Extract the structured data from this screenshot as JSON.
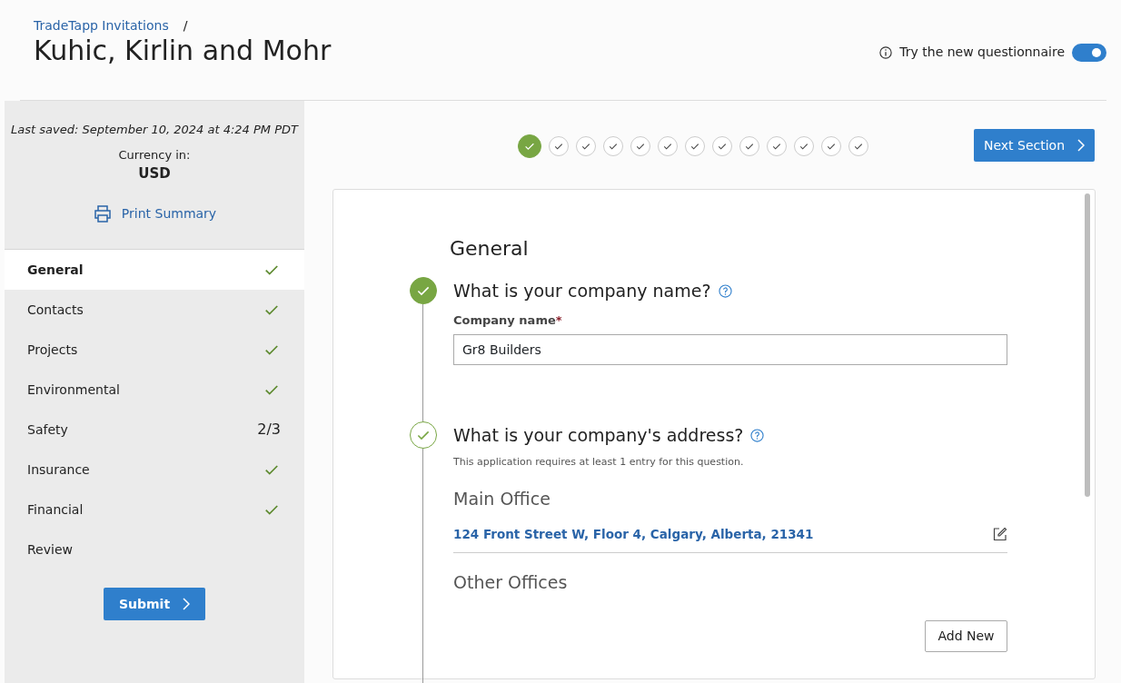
{
  "breadcrumb": {
    "link": "TradeTapp Invitations",
    "separator": "/"
  },
  "page_title": "Kuhic, Kirlin and Mohr",
  "new_questionnaire": {
    "label": "Try the new questionnaire",
    "on": true
  },
  "sidebar": {
    "last_saved": "Last saved: September 10, 2024 at 4:24 PM PDT",
    "currency_label": "Currency in:",
    "currency": "USD",
    "print_link": "Print Summary",
    "items": [
      {
        "label": "General",
        "selected": true,
        "complete": true
      },
      {
        "label": "Contacts",
        "selected": false,
        "complete": true
      },
      {
        "label": "Projects",
        "selected": false,
        "complete": true
      },
      {
        "label": "Environmental",
        "selected": false,
        "complete": true
      },
      {
        "label": "Safety",
        "selected": false,
        "complete": false,
        "progress": "2/3"
      },
      {
        "label": "Insurance",
        "selected": false,
        "complete": true
      },
      {
        "label": "Financial",
        "selected": false,
        "complete": true
      },
      {
        "label": "Review",
        "selected": false,
        "complete": false
      }
    ],
    "submit": "Submit"
  },
  "steps": [
    {
      "selected": true
    },
    {
      "selected": false
    },
    {
      "selected": false
    },
    {
      "selected": false
    },
    {
      "selected": false
    },
    {
      "selected": false
    },
    {
      "selected": false
    },
    {
      "selected": false
    },
    {
      "selected": false
    },
    {
      "selected": false
    },
    {
      "selected": false
    },
    {
      "selected": false
    },
    {
      "selected": false
    }
  ],
  "next_button": "Next Section",
  "section_title": "General",
  "questions": [
    {
      "title": "What is your company name?",
      "active": true,
      "field_label": "Company name",
      "required_mark": "*",
      "value": "Gr8 Builders"
    },
    {
      "title": "What is your company's address?",
      "active": false,
      "note": "This application requires at least 1 entry for this question.",
      "main_heading": "Main Office",
      "address": "124 Front Street W, Floor 4, Calgary, Alberta, 21341",
      "other_heading": "Other Offices",
      "add_button": "Add New"
    }
  ]
}
